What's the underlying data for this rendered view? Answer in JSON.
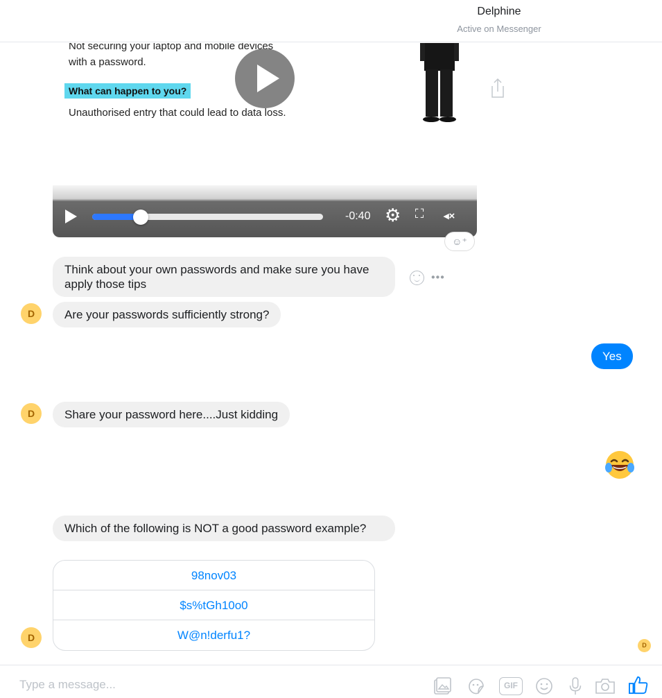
{
  "header": {
    "contact_name": "Delphine",
    "contact_status": "Active on Messenger"
  },
  "video": {
    "slide_line_1": "Not securing your laptop and mobile devices",
    "slide_line_2": "with a password.",
    "slide_highlight": "What can happen to you?",
    "slide_line_3": "Unauthorised entry that could lead to data loss.",
    "time_remaining": "-0:40",
    "progress_fraction": 0.21
  },
  "messages": {
    "m1": "Think about your own passwords and make sure you have apply those tips",
    "m2": "Are your passwords sufficiently strong?",
    "reply_yes": "Yes",
    "m3": "Share your password here....Just kidding",
    "m4": "Which of the following is NOT a good password example?"
  },
  "avatar_initial": "D",
  "quick_replies": [
    "98nov03",
    "$s%tGh10o0",
    "W@n!derfu1?"
  ],
  "composer": {
    "placeholder": "Type a message...",
    "gif_label": "GIF"
  },
  "icons": [
    "play-icon",
    "share-icon",
    "gear-icon",
    "fullscreen-icon",
    "mute-icon",
    "add-reaction-icon",
    "smiley-icon",
    "more-icon",
    "laughing-emoji",
    "photo-icon",
    "sticker-icon",
    "gif-icon",
    "emoji-icon",
    "microphone-icon",
    "camera-icon",
    "like-icon"
  ],
  "colors": {
    "accent": "#0084ff",
    "bubble_gray": "#f0f0f0",
    "avatar": "#ffd36b",
    "highlight": "#5fd7ee"
  }
}
